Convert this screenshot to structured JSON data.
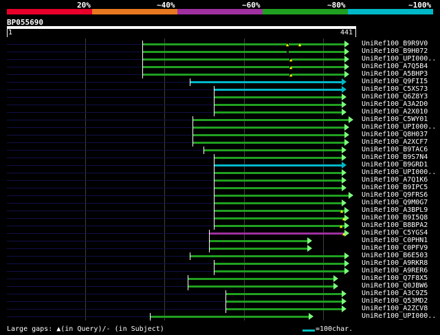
{
  "legend": {
    "labels": [
      "20%",
      "~40%",
      "~60%",
      "~80%",
      "~100%"
    ],
    "colors": [
      "#e8002a",
      "#e87820",
      "#a030a0",
      "#20a020",
      "#00b8c8"
    ]
  },
  "query": {
    "name": "BP055690",
    "start": "1",
    "end": "441"
  },
  "footer": {
    "gaps_text": "Large gaps: ▲(in Query)/- (in Subject)",
    "scale_text": "=100char."
  },
  "hits": [
    {
      "label": "UniRef100_B9R9V0",
      "start": 207,
      "end": 505,
      "color": "#20a020",
      "gaps": [
        416,
        434
      ],
      "bgap": 417
    },
    {
      "label": "UniRef100_B9H072",
      "start": 207,
      "end": 505,
      "color": "#20a020",
      "gaps": [],
      "bgap": 417
    },
    {
      "label": "UniRef100_UPI000..",
      "start": 207,
      "end": 505,
      "color": "#20a020",
      "gaps": [
        421
      ],
      "bgap": 421
    },
    {
      "label": "UniRef100_A7Q5B4",
      "start": 207,
      "end": 505,
      "color": "#20a020",
      "gaps": [
        421
      ],
      "bgap": 421
    },
    {
      "label": "UniRef100_A5BHP3",
      "start": 207,
      "end": 505,
      "color": "#20a020",
      "gaps": [
        421
      ],
      "bgap": 421
    },
    {
      "label": "UniRef100_Q9FII5",
      "start": 276,
      "end": 501,
      "color": "#00b8c8",
      "gaps": [],
      "bgap": null
    },
    {
      "label": "UniRef100_C5XS73",
      "start": 311,
      "end": 501,
      "color": "#00b8c8",
      "gaps": [],
      "bgap": null
    },
    {
      "label": "UniRef100_Q6Z8Y3",
      "start": 311,
      "end": 501,
      "color": "#20a020",
      "gaps": [],
      "bgap": null
    },
    {
      "label": "UniRef100_A3A2D0",
      "start": 311,
      "end": 501,
      "color": "#20a020",
      "gaps": [],
      "bgap": null
    },
    {
      "label": "UniRef100_A2X010",
      "start": 311,
      "end": 501,
      "color": "#20a020",
      "gaps": [],
      "bgap": null
    },
    {
      "label": "UniRef100_C5WY01",
      "start": 280,
      "end": 511,
      "color": "#20a020",
      "gaps": [],
      "bgap": null
    },
    {
      "label": "UniRef100_UPI000..",
      "start": 280,
      "end": 505,
      "color": "#20a020",
      "gaps": [],
      "bgap": null
    },
    {
      "label": "UniRef100_Q8H037",
      "start": 280,
      "end": 505,
      "color": "#20a020",
      "gaps": [],
      "bgap": null
    },
    {
      "label": "UniRef100_A2XCF7",
      "start": 280,
      "end": 505,
      "color": "#20a020",
      "gaps": [],
      "bgap": null
    },
    {
      "label": "UniRef100_B9TAC6",
      "start": 296,
      "end": 501,
      "color": "#20a020",
      "gaps": [],
      "bgap": null
    },
    {
      "label": "UniRef100_B9S7N4",
      "start": 311,
      "end": 501,
      "color": "#20a020",
      "gaps": [],
      "bgap": null
    },
    {
      "label": "UniRef100_B9GRD1",
      "start": 311,
      "end": 501,
      "color": "#00b8c8",
      "gaps": [],
      "bgap": null
    },
    {
      "label": "UniRef100_UPI000..",
      "start": 311,
      "end": 501,
      "color": "#20a020",
      "gaps": [],
      "bgap": null
    },
    {
      "label": "UniRef100_A7Q1K6",
      "start": 311,
      "end": 501,
      "color": "#20a020",
      "gaps": [],
      "bgap": null
    },
    {
      "label": "UniRef100_B9IPC5",
      "start": 311,
      "end": 501,
      "color": "#20a020",
      "gaps": [],
      "bgap": null
    },
    {
      "label": "UniRef100_Q9FRS6",
      "start": 311,
      "end": 511,
      "color": "#20a020",
      "gaps": [],
      "bgap": null
    },
    {
      "label": "UniRef100_Q9M0G7",
      "start": 311,
      "end": 501,
      "color": "#20a020",
      "gaps": [],
      "bgap": null
    },
    {
      "label": "UniRef100_A3BPL9",
      "start": 311,
      "end": 505,
      "color": "#20a020",
      "gaps": [
        495
      ],
      "bgap": null
    },
    {
      "label": "UniRef100_B9I5Q8",
      "start": 311,
      "end": 505,
      "color": "#20a020",
      "gaps": [
        498
      ],
      "bgap": null
    },
    {
      "label": "UniRef100_B8BPA2",
      "start": 311,
      "end": 505,
      "color": "#20a020",
      "gaps": [
        494
      ],
      "bgap": null
    },
    {
      "label": "UniRef100_C5YGS4",
      "start": 304,
      "end": 505,
      "color": "#a030a0",
      "gaps": [
        498
      ],
      "bgap": null
    },
    {
      "label": "UniRef100_C0PHN1",
      "start": 304,
      "end": 451,
      "color": "#20a020",
      "gaps": [],
      "bgap": null
    },
    {
      "label": "UniRef100_C0PFV9",
      "start": 304,
      "end": 451,
      "color": "#20a020",
      "gaps": [],
      "bgap": null
    },
    {
      "label": "UniRef100_B6E503",
      "start": 276,
      "end": 505,
      "color": "#20a020",
      "gaps": [],
      "bgap": null
    },
    {
      "label": "UniRef100_A9RKR8",
      "start": 311,
      "end": 505,
      "color": "#20a020",
      "gaps": [],
      "bgap": null
    },
    {
      "label": "UniRef100_A9RER6",
      "start": 311,
      "end": 505,
      "color": "#20a020",
      "gaps": [],
      "bgap": null
    },
    {
      "label": "UniRef100_Q7F8X5",
      "start": 273,
      "end": 489,
      "color": "#20a020",
      "gaps": [],
      "bgap": null
    },
    {
      "label": "UniRef100_Q0JBW6",
      "start": 273,
      "end": 489,
      "color": "#20a020",
      "gaps": [],
      "bgap": null
    },
    {
      "label": "UniRef100_A3C9Z5",
      "start": 328,
      "end": 501,
      "color": "#20a020",
      "gaps": [],
      "bgap": null
    },
    {
      "label": "UniRef100_Q53MD2",
      "start": 328,
      "end": 501,
      "color": "#20a020",
      "gaps": [],
      "bgap": null
    },
    {
      "label": "UniRef100_A2ZCV8",
      "start": 328,
      "end": 501,
      "color": "#20a020",
      "gaps": [],
      "bgap": null
    },
    {
      "label": "UniRef100_UPI000..",
      "start": 218,
      "end": 453,
      "color": "#20a020",
      "gaps": [],
      "bgap": null
    }
  ]
}
